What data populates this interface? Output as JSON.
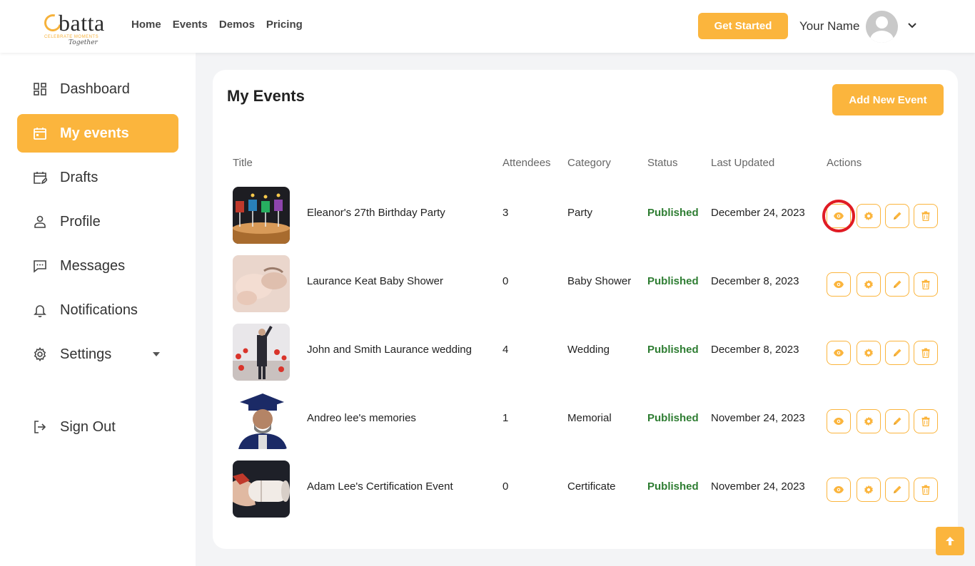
{
  "header": {
    "logo_text": "batta",
    "logo_tagline": "CELEBRATE MOMENTS",
    "logo_script": "Together",
    "nav": [
      "Home",
      "Events",
      "Demos",
      "Pricing"
    ],
    "cta_label": "Get Started",
    "user_name": "Your Name"
  },
  "sidebar": {
    "items": [
      {
        "label": "Dashboard",
        "icon": "dashboard-icon"
      },
      {
        "label": "My events",
        "icon": "calendar-icon",
        "active": true
      },
      {
        "label": "Drafts",
        "icon": "calendar-edit-icon"
      },
      {
        "label": "Profile",
        "icon": "user-icon"
      },
      {
        "label": "Messages",
        "icon": "message-icon"
      },
      {
        "label": "Notifications",
        "icon": "bell-icon"
      },
      {
        "label": "Settings",
        "icon": "gear-icon"
      },
      {
        "label": "Sign Out",
        "icon": "sign-out-icon"
      }
    ]
  },
  "main": {
    "title": "My Events",
    "add_button": "Add New Event",
    "columns": [
      "Title",
      "Attendees",
      "Category",
      "Status",
      "Last Updated",
      "Actions"
    ],
    "rows": [
      {
        "title": "Eleanor's 27th Birthday Party",
        "attendees": "3",
        "category": "Party",
        "status": "Published",
        "updated": "December 24, 2023"
      },
      {
        "title": "Laurance Keat Baby Shower",
        "attendees": "0",
        "category": "Baby Shower",
        "status": "Published",
        "updated": "December 8, 2023"
      },
      {
        "title": "John and Smith Laurance wedding",
        "attendees": "4",
        "category": "Wedding",
        "status": "Published",
        "updated": "December 8, 2023"
      },
      {
        "title": "Andreo lee's memories",
        "attendees": "1",
        "category": "Memorial",
        "status": "Published",
        "updated": "November 24, 2023"
      },
      {
        "title": "Adam Lee's Certification Event",
        "attendees": "0",
        "category": "Certificate",
        "status": "Published",
        "updated": "November 24, 2023"
      }
    ]
  },
  "colors": {
    "accent": "#fbb53d",
    "published": "#2e7d32",
    "highlight": "#e01b24"
  }
}
